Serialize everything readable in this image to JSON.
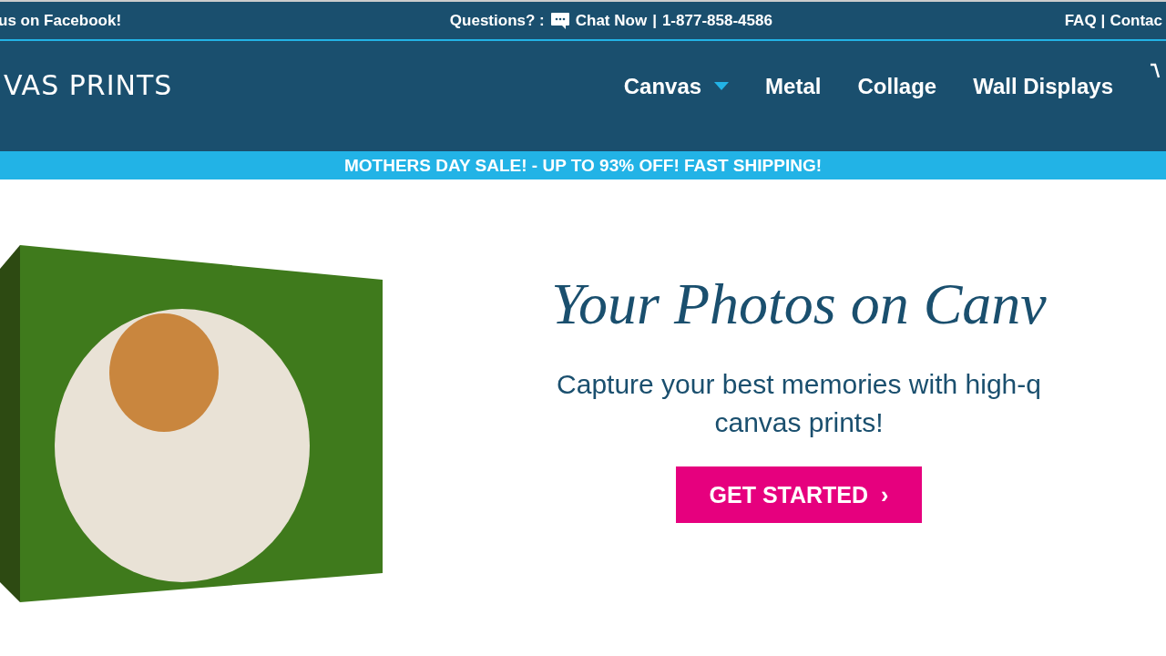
{
  "top_bar": {
    "facebook_text": "us on Facebook!",
    "questions_label": "Questions? :",
    "chat_link": "Chat Now",
    "separator": "|",
    "phone": "1-877-858-4586",
    "faq_link": "FAQ",
    "separator_2": "|",
    "contact_link": "Contac"
  },
  "header": {
    "logo_text": "VAS PRINTS",
    "nav": [
      {
        "label": "Canvas",
        "has_dropdown": true
      },
      {
        "label": "Metal",
        "has_dropdown": false
      },
      {
        "label": "Collage",
        "has_dropdown": false
      },
      {
        "label": "Wall Displays",
        "has_dropdown": false
      }
    ]
  },
  "promo_banner": "MOTHERS DAY SALE! - UP TO 93% OFF! FAST SHIPPING!",
  "hero": {
    "title": "Your Photos on Canv",
    "subtitle": "Capture your best memories with high-q",
    "subtitle_line_2": "canvas prints!",
    "cta": "GET STARTED",
    "cta_arrow": "›"
  }
}
